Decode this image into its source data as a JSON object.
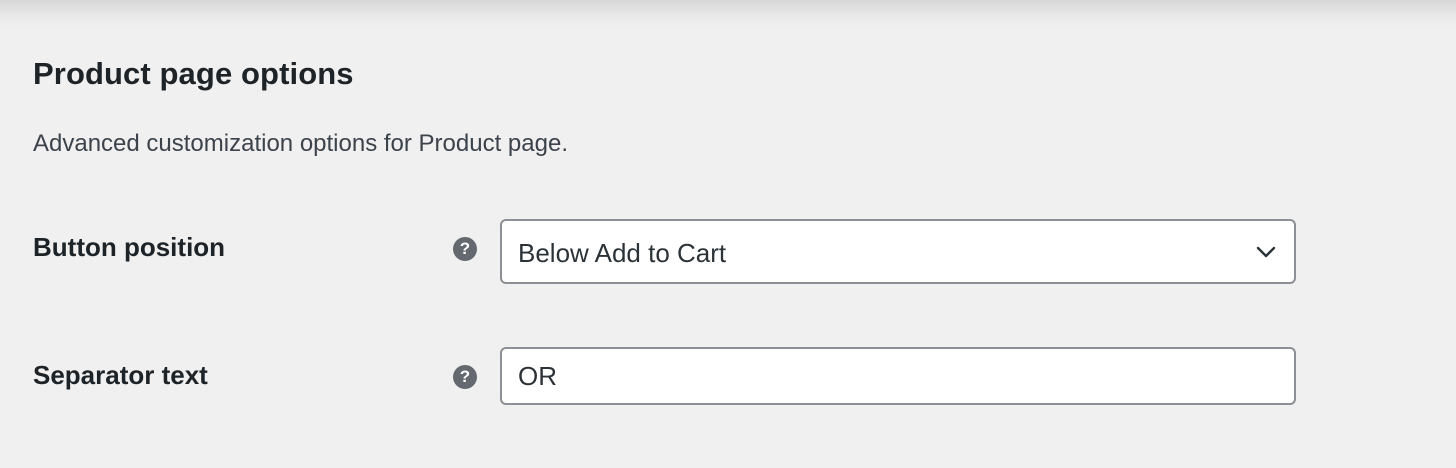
{
  "section": {
    "title": "Product page options",
    "description": "Advanced customization options for Product page."
  },
  "fields": {
    "button_position": {
      "label": "Button position",
      "help_icon": "question-circle-icon",
      "selected": "Below Add to Cart",
      "dropdown_icon": "chevron-down-icon"
    },
    "separator_text": {
      "label": "Separator text",
      "help_icon": "question-circle-icon",
      "value": "OR"
    }
  },
  "colors": {
    "page_background": "#f0f0f1",
    "heading_text": "#1d2327",
    "help_icon": "#646970",
    "input_border": "#8c8f94",
    "input_background": "#ffffff"
  }
}
